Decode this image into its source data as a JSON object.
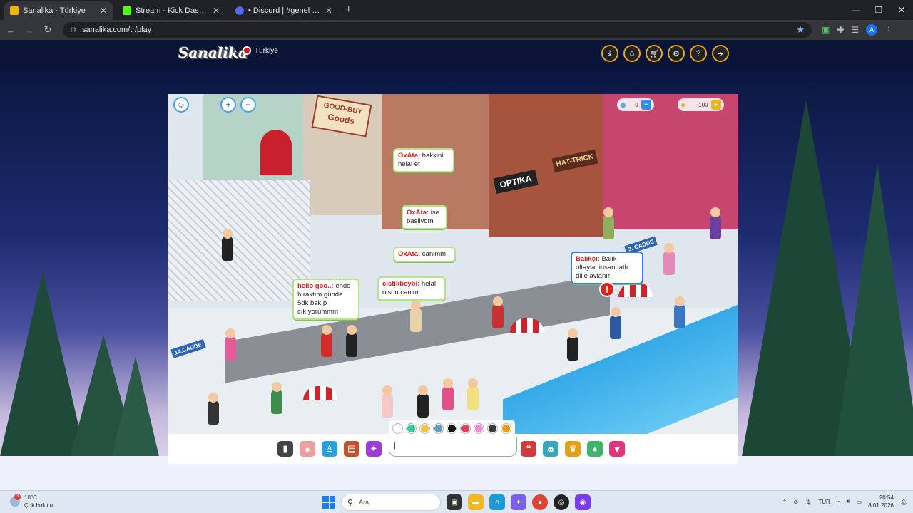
{
  "browser": {
    "tabs": [
      {
        "title": "Sanalika - Türkiye",
        "active": true,
        "color": "#f6b300"
      },
      {
        "title": "Stream - Kick Dashboard",
        "active": false,
        "color": "#53fc18"
      },
      {
        "title": "• Discord | #genel | survivo",
        "active": false,
        "color": "#5865f2"
      }
    ],
    "url": "sanalika.com/tr/play",
    "profile_initial": "A"
  },
  "site": {
    "logo": "Sanalika",
    "region": "Türkiye",
    "header_icons": [
      "download-icon",
      "home-icon",
      "cart-icon",
      "gear-icon",
      "help-icon",
      "logout-icon"
    ]
  },
  "game": {
    "currency": {
      "gems": "0",
      "coins": "100"
    },
    "signs": {
      "good_buy_1": "GOOD-BUY",
      "good_buy_2": "Goods",
      "optika": "OPTIKA",
      "hat_trick": "HAT-TRICK",
      "cadde_14": "14.CADDE",
      "cadde_3": "3. CADDE"
    },
    "chat": [
      {
        "name": "OxAta:",
        "text": "hakkini helal et"
      },
      {
        "name": "OxAta:",
        "text": "ise basliyom"
      },
      {
        "name": "OxAta:",
        "text": "canimm"
      },
      {
        "name": "cistikbeybi:",
        "text": "helal olsun canim"
      },
      {
        "name": "hello goo..:",
        "text": "ende bıraktım günde 5dk bakıp cıkıyorummm"
      },
      {
        "name": "Balıkçı:",
        "text": "Balık oltayla, insan tatlı dille avlanır!"
      }
    ],
    "palette": [
      "#ffffff",
      "#2ecc9a",
      "#f5c542",
      "#5aa0c8",
      "#111111",
      "#d9435a",
      "#f28ad6",
      "#7a7a7a",
      "#f39c12"
    ],
    "chat_input_value": "|"
  },
  "taskbar": {
    "weather_temp": "10°C",
    "weather_desc": "Çok bulutlu",
    "weather_badge": "3",
    "search_placeholder": "Ara",
    "lang": "TUR",
    "time": "20:54",
    "date": "8.01.2026"
  }
}
